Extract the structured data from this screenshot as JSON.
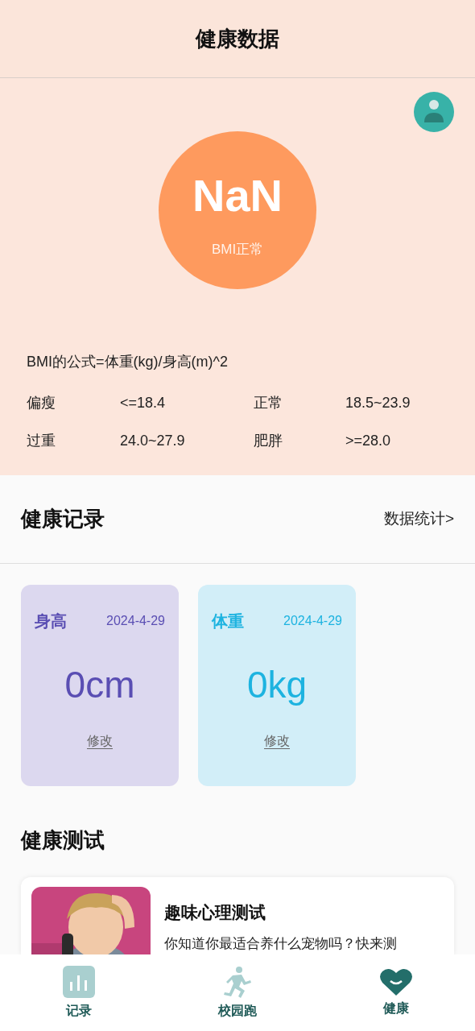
{
  "header": {
    "title": "健康数据"
  },
  "bmi": {
    "value": "NaN",
    "status": "BMI正常",
    "formula": "BMI的公式=体重(kg)/身高(m)^2",
    "ranges": [
      {
        "label": "偏瘦",
        "value": "<=18.4"
      },
      {
        "label": "正常",
        "value": "18.5~23.9"
      },
      {
        "label": "过重",
        "value": "24.0~27.9"
      },
      {
        "label": "肥胖",
        "value": ">=28.0"
      }
    ]
  },
  "records": {
    "title": "健康记录",
    "link": "数据统计>",
    "cards": [
      {
        "kind": "height",
        "label": "身高",
        "date": "2024-4-29",
        "value": "0cm",
        "action": "修改"
      },
      {
        "kind": "weight",
        "label": "体重",
        "date": "2024-4-29",
        "value": "0kg",
        "action": "修改"
      }
    ]
  },
  "tests": {
    "title": "健康测试",
    "items": [
      {
        "kind": "picture",
        "title": "趣味心理测试",
        "description": "你知道你最适合养什么宠物吗？快来测"
      }
    ]
  },
  "tab_bar": [
    {
      "kind": "chart",
      "label": "记录",
      "selected": false
    },
    {
      "kind": "run",
      "label": "校园跑",
      "selected": false
    },
    {
      "kind": "heart",
      "label": "健康",
      "selected": true
    }
  ]
}
